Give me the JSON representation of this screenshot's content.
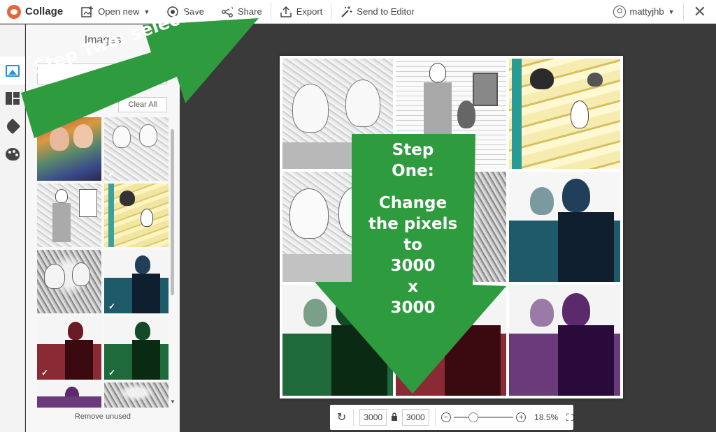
{
  "toolbar": {
    "brand": "Collage",
    "open_new": "Open new",
    "save": "Save",
    "share": "Share",
    "export": "Export",
    "send_to_editor": "Send to Editor",
    "username": "mattyjhb"
  },
  "panel": {
    "title": "Images",
    "clear_all": "Clear All",
    "remove_unused": "Remove unused",
    "check_mark": "✓"
  },
  "zoom": {
    "width_px": "3000",
    "height_px": "3000",
    "percent": "18.5%",
    "slider_level": 0.32
  },
  "annotations": {
    "step_two": "Step Two: select “Export”",
    "step_one_line1": "Step",
    "step_one_line2": "One:",
    "step_one_line3": "Change",
    "step_one_line4": "the pixels",
    "step_one_line5": "to",
    "step_one_line6": "3000",
    "step_one_line7": "x",
    "step_one_line8": "3000"
  },
  "colors": {
    "annotation_green": "#2e9b3e",
    "accent_blue": "#2a8fd8",
    "canvas_bg": "#3a3a3a"
  }
}
